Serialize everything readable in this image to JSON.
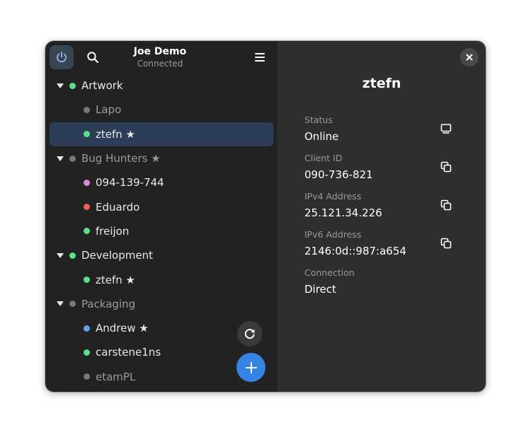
{
  "header": {
    "title": "Joe Demo",
    "subtitle": "Connected",
    "icons": {
      "power": "power-icon",
      "search": "search-icon",
      "menu": "hamburger-menu-icon"
    }
  },
  "groups": [
    {
      "name": "Artwork",
      "status_color": "#57e389",
      "muted": false,
      "peers": [
        {
          "name": "Lapo",
          "status_color": "#777777",
          "muted": true,
          "selected": false
        },
        {
          "name": "ztefn ★",
          "status_color": "#57e389",
          "muted": false,
          "selected": true
        }
      ]
    },
    {
      "name": "Bug Hunters ★",
      "status_color": "#777777",
      "muted": true,
      "peers": [
        {
          "name": "094-139-744",
          "status_color": "#dc8add",
          "muted": false,
          "selected": false
        },
        {
          "name": "Eduardo",
          "status_color": "#ed5d5d",
          "muted": false,
          "selected": false
        },
        {
          "name": "freijon",
          "status_color": "#57e389",
          "muted": false,
          "selected": false
        }
      ]
    },
    {
      "name": "Development",
      "status_color": "#57e389",
      "muted": false,
      "peers": [
        {
          "name": "ztefn ★",
          "status_color": "#57e389",
          "muted": false,
          "selected": false
        }
      ]
    },
    {
      "name": "Packaging",
      "status_color": "#777777",
      "muted": true,
      "peers": [
        {
          "name": "Andrew ★",
          "status_color": "#62a0ea",
          "muted": false,
          "selected": false
        },
        {
          "name": "carstene1ns",
          "status_color": "#57e389",
          "muted": false,
          "selected": false
        },
        {
          "name": "etamPL",
          "status_color": "#777777",
          "muted": true,
          "selected": false
        }
      ]
    }
  ],
  "detail": {
    "title": "ztefn",
    "fields": [
      {
        "label": "Status",
        "value": "Online",
        "action_icon": "monitor-icon"
      },
      {
        "label": "Client ID",
        "value": "090-736-821",
        "action_icon": "copy-icon"
      },
      {
        "label": "IPv4 Address",
        "value": "25.121.34.226",
        "action_icon": "copy-icon"
      },
      {
        "label": "IPv6 Address",
        "value": "2146:0d::987:a654",
        "action_icon": "copy-icon"
      },
      {
        "label": "Connection",
        "value": "Direct",
        "action_icon": ""
      }
    ]
  },
  "colors": {
    "accent": "#3584e4",
    "online": "#57e389",
    "offline": "#777777",
    "selection": "#2c3e57"
  }
}
